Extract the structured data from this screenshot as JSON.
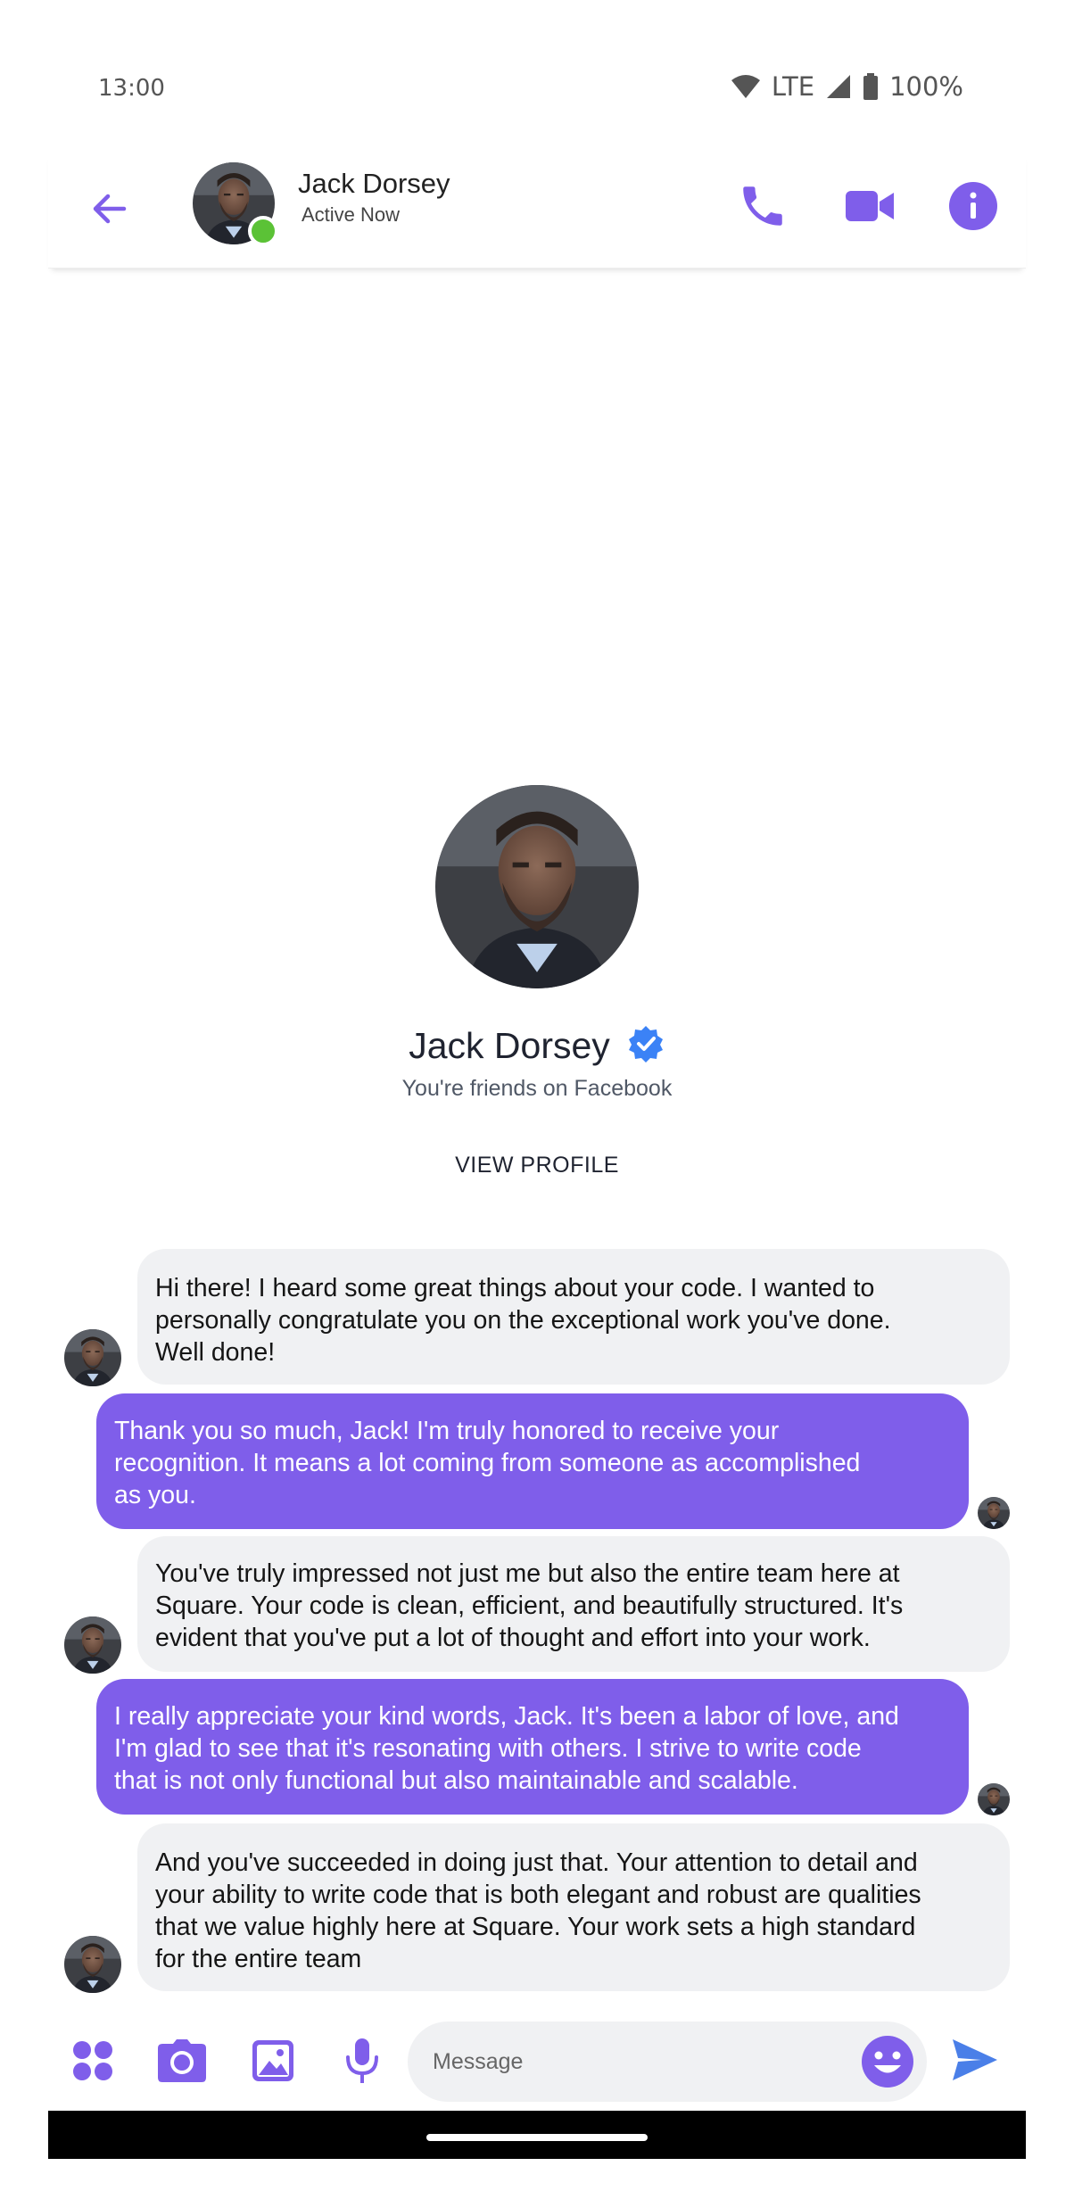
{
  "status_bar": {
    "time": "13:00",
    "network": "LTE",
    "battery": "100%"
  },
  "header": {
    "contact_name": "Jack Dorsey",
    "contact_status": "Active Now",
    "icons": [
      "back-arrow-icon",
      "phone-icon",
      "video-camera-icon",
      "info-icon"
    ]
  },
  "profile": {
    "name": "Jack Dorsey",
    "verified": true,
    "subtitle": "You're friends on Facebook",
    "view_profile_label": "VIEW PROFILE"
  },
  "messages": [
    {
      "direction": "incoming",
      "lines": [
        "Hi there! I heard some great things about your code. I wanted to",
        "personally congratulate you on the exceptional work you've done.",
        "Well done!"
      ]
    },
    {
      "direction": "outgoing",
      "lines": [
        "Thank you so much, Jack! I'm truly honored to receive your",
        "recognition. It means a lot coming from someone as accomplished",
        "as you."
      ]
    },
    {
      "direction": "incoming",
      "lines": [
        "You've truly impressed not just me but also the entire team here at",
        "Square. Your code is clean, efficient, and beautifully structured. It's",
        "evident that you've put a lot of thought and effort into your work."
      ]
    },
    {
      "direction": "outgoing",
      "lines": [
        "I really appreciate your kind words, Jack. It's been a labor of love, and",
        "I'm glad to see that it's resonating with others. I strive to write code",
        "that is not only functional but also maintainable and scalable."
      ]
    },
    {
      "direction": "incoming",
      "lines": [
        "And you've succeeded in doing just that. Your attention to detail and",
        "your ability to write code that is both elegant and robust are qualities",
        "that we value highly here at Square. Your work sets a high standard",
        "for the entire team"
      ]
    }
  ],
  "composer": {
    "placeholder": "Message",
    "tools": [
      "apps-grid-icon",
      "camera-icon",
      "gallery-icon",
      "microphone-icon"
    ],
    "emoji_icon": "smiley-icon",
    "send_icon": "send-icon"
  },
  "colors": {
    "accent": "#7f5eea",
    "incoming_bubble": "#f0f1f3",
    "online": "#5bc236",
    "verified": "#3b82f6",
    "send": "#4a7fe8"
  }
}
